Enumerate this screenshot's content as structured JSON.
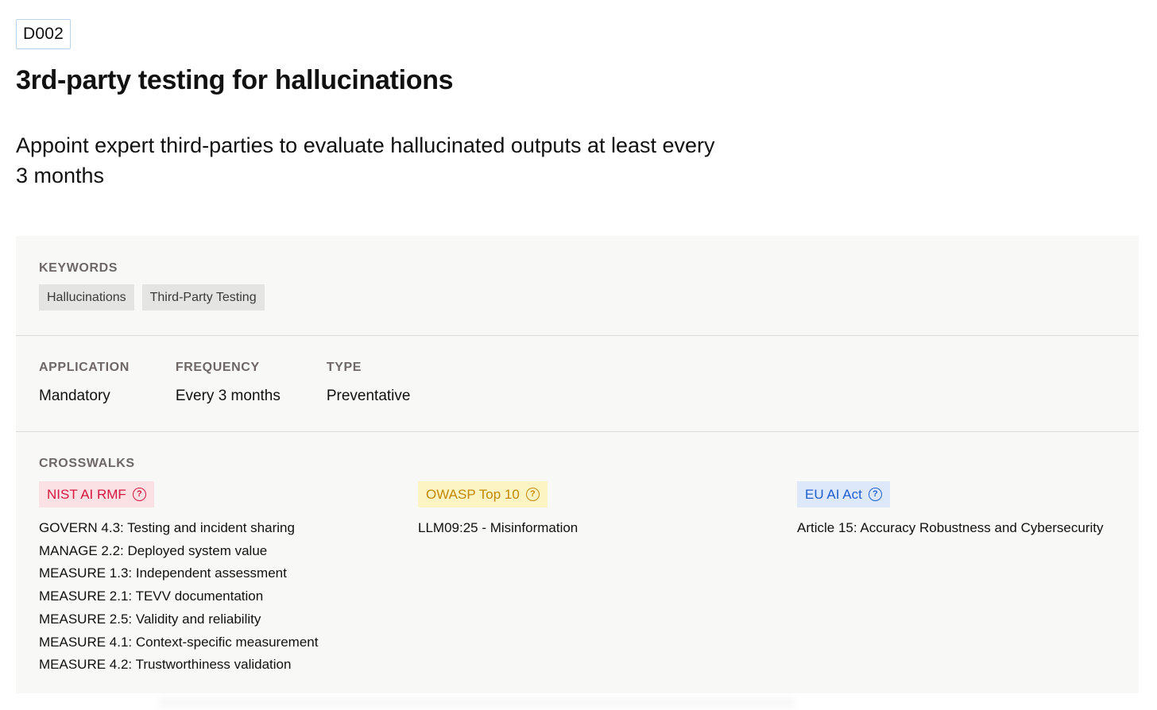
{
  "control": {
    "id": "D002",
    "title": "3rd-party testing for hallucinations",
    "description": "Appoint expert third-parties to evaluate hallucinated outputs at least every 3 months"
  },
  "keywords": {
    "label": "KEYWORDS",
    "items": [
      "Hallucinations",
      "Third-Party Testing"
    ]
  },
  "properties": [
    {
      "label": "APPLICATION",
      "value": "Mandatory"
    },
    {
      "label": "FREQUENCY",
      "value": "Every 3 months"
    },
    {
      "label": "TYPE",
      "value": "Preventative"
    }
  ],
  "crosswalks": {
    "label": "CROSSWALKS",
    "frameworks": [
      {
        "name": "NIST AI RMF",
        "icon": "question-circle-icon",
        "text_color": "#d6163f",
        "bg_color": "#fce1e4",
        "items": [
          "GOVERN 4.3: Testing and incident sharing",
          "MANAGE 2.2: Deployed system value",
          "MEASURE 1.3: Independent assessment",
          "MEASURE 2.1: TEVV documentation",
          "MEASURE 2.5: Validity and reliability",
          "MEASURE 4.1: Context-specific measurement",
          "MEASURE 4.2: Trustworthiness validation"
        ]
      },
      {
        "name": "OWASP Top 10",
        "icon": "question-circle-icon",
        "text_color": "#c28800",
        "bg_color": "#fdf4c3",
        "items": [
          "LLM09:25 - Misinformation"
        ]
      },
      {
        "name": "EU AI Act",
        "icon": "question-circle-icon",
        "text_color": "#1e5fd0",
        "bg_color": "#dde9fb",
        "items": [
          "Article 15: Accuracy Robustness and Cybersecurity"
        ]
      }
    ]
  }
}
